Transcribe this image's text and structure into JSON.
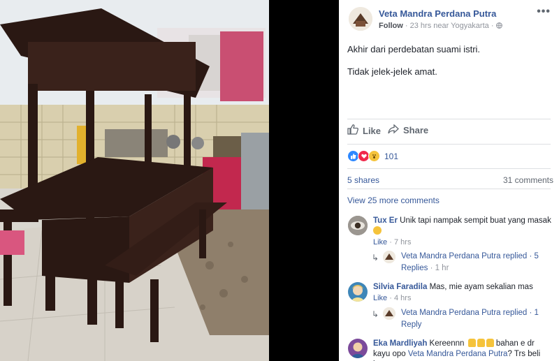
{
  "post": {
    "page_name": "Veta Mandra Perdana Putra",
    "follow_label": "Follow",
    "time": "23 hrs near Yogyakarta",
    "more_label": "•••",
    "text_line1": "Akhir dari perdebatan suami istri.",
    "text_line2": "Tidak jelek-jelek amat."
  },
  "actions": {
    "like_label": "Like",
    "share_label": "Share"
  },
  "stats": {
    "reaction_count": "101",
    "shares": "5 shares",
    "comments": "31 comments"
  },
  "comments_section": {
    "view_more": "View 25 more comments",
    "comment1": {
      "author": "Tux Er",
      "text": "Unik tapi nampak sempit buat yang masak",
      "like": "Like",
      "time": "7 hrs",
      "reply_author": "Veta Mandra Perdana Putra",
      "reply_text": "replied",
      "reply_count": "5 Replies",
      "reply_time": "1 hr"
    },
    "comment2": {
      "author": "Silvia Faradila",
      "text": "Mas, mie ayam sekalian mas",
      "like": "Like",
      "time": "4 hrs",
      "reply_author": "Veta Mandra Perdana Putra",
      "reply_text": "replied",
      "reply_count": "1 Reply"
    },
    "comment3": {
      "author": "Eka Mardliyah",
      "text_a": "Kereennn",
      "text_b": "bahan e dr kayu opo",
      "mention": "Veta Mandra Perdana Putra",
      "text_c": "? Trs beli lgs apa"
    }
  },
  "colors": {
    "link": "#365899",
    "meta": "#90949c",
    "divider": "#dddfe2",
    "like_blue": "#2d88ff",
    "love_red": "#f0284a",
    "wow_yellow": "#f5c33b"
  }
}
